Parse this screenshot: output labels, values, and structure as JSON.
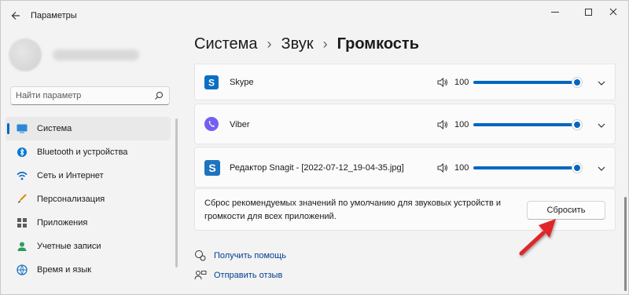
{
  "window": {
    "title": "Параметры"
  },
  "sidebar": {
    "search_placeholder": "Найти параметр",
    "items": [
      {
        "label": "Система",
        "icon": "monitor-icon"
      },
      {
        "label": "Bluetooth и устройства",
        "icon": "bluetooth-icon"
      },
      {
        "label": "Сеть и Интернет",
        "icon": "wifi-icon"
      },
      {
        "label": "Персонализация",
        "icon": "brush-icon"
      },
      {
        "label": "Приложения",
        "icon": "apps-icon"
      },
      {
        "label": "Учетные записи",
        "icon": "account-icon"
      },
      {
        "label": "Время и язык",
        "icon": "globe-clock-icon"
      }
    ],
    "active_index": 0
  },
  "breadcrumb": {
    "items": [
      "Система",
      "Звук"
    ],
    "current": "Громкость",
    "separator": "›"
  },
  "apps": [
    {
      "name": "Skype",
      "volume": "100",
      "level": 1.0,
      "icon": "skype-icon",
      "color": "#0078d4"
    },
    {
      "name": "Viber",
      "volume": "100",
      "level": 1.0,
      "icon": "viber-icon",
      "color": "#7360f2"
    },
    {
      "name": "Редактор Snagit - [2022-07-12_19-04-35.jpg]",
      "volume": "100",
      "level": 1.0,
      "icon": "snagit-icon",
      "color": "#1e73be"
    }
  ],
  "reset": {
    "description": "Сброс рекомендуемых значений по умолчанию для звуковых устройств и громкости для всех приложений.",
    "button_label": "Сбросить"
  },
  "links": {
    "help": "Получить помощь",
    "feedback": "Отправить отзыв"
  },
  "colors": {
    "accent": "#0067c0",
    "annotation_arrow": "#e0262a"
  }
}
